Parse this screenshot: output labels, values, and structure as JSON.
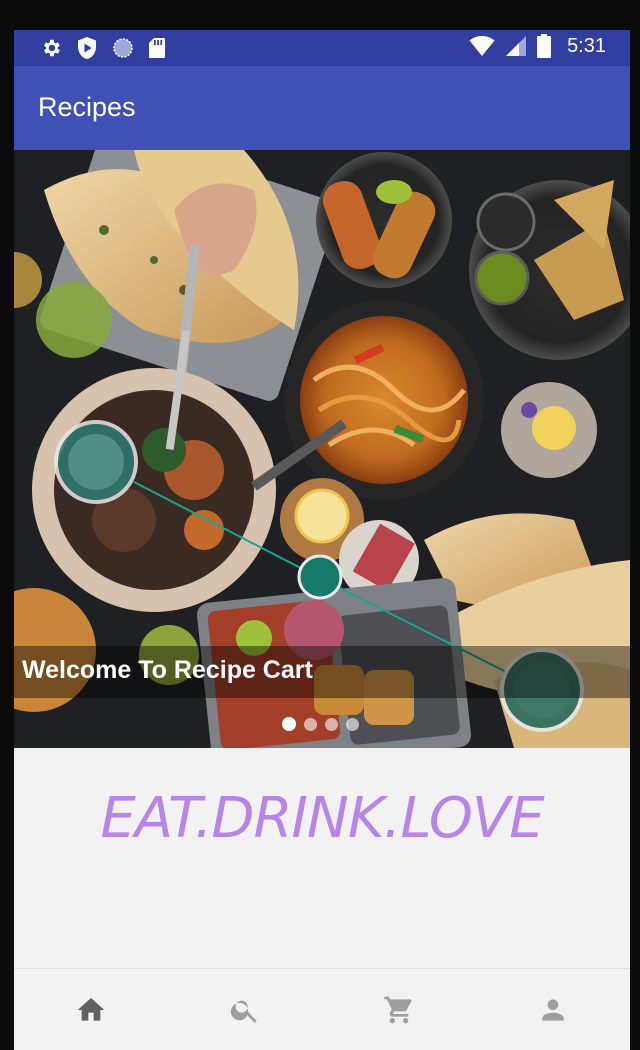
{
  "status_bar": {
    "time": "5:31",
    "left_icons": [
      "settings-icon",
      "play-protect-icon",
      "sync-icon",
      "sd-card-icon"
    ],
    "right_icons": [
      "wifi-icon",
      "signal-icon",
      "battery-icon"
    ]
  },
  "app_bar": {
    "title": "Recipes"
  },
  "banner": {
    "caption": "Welcome To Recipe Cart",
    "slide_count": 4,
    "active_slide": 1
  },
  "tagline": "EAT.DRINK.LOVE",
  "bottom_nav": {
    "items": [
      {
        "icon": "home-icon",
        "active": true
      },
      {
        "icon": "search-icon",
        "active": false
      },
      {
        "icon": "cart-icon",
        "active": false
      },
      {
        "icon": "profile-icon",
        "active": false
      }
    ]
  },
  "colors": {
    "status_bar": "#303f9f",
    "app_bar": "#3f51b5",
    "tagline": "#b685e8",
    "nav_active": "#616161",
    "nav_inactive": "#9e9e9e",
    "hotspot": "#1aa68a"
  }
}
